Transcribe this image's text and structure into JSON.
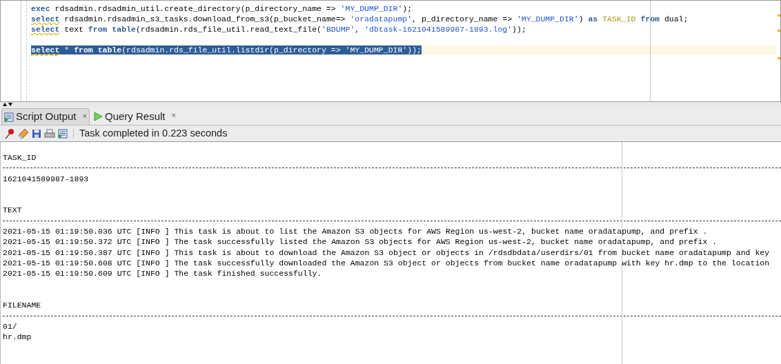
{
  "editor": {
    "lines": [
      {
        "selected": false,
        "tokens": [
          {
            "kind": "keyword",
            "text": "exec",
            "squiggle": false
          },
          {
            "kind": "plain",
            "text": " rdsadmin.rdsadmin_util.create_directory(p_directory_name => "
          },
          {
            "kind": "string",
            "text": "'MY_DUMP_DIR'"
          },
          {
            "kind": "plain",
            "text": ");"
          }
        ]
      },
      {
        "selected": false,
        "tokens": [
          {
            "kind": "keyword",
            "text": "select",
            "squiggle": true
          },
          {
            "kind": "plain",
            "text": " rdsadmin.rdsadmin_s3_tasks.download_from_s3(p_bucket_name=> "
          },
          {
            "kind": "string",
            "text": "'oradatapump'"
          },
          {
            "kind": "plain",
            "text": ", p_directory_name => "
          },
          {
            "kind": "string",
            "text": "'MY_DUMP_DIR'"
          },
          {
            "kind": "plain",
            "text": ") "
          },
          {
            "kind": "keyword",
            "text": "as",
            "squiggle": false
          },
          {
            "kind": "alias",
            "text": " TASK_ID"
          },
          {
            "kind": "keyword",
            "text": " from",
            "squiggle": false
          },
          {
            "kind": "plain",
            "text": " dual;"
          }
        ]
      },
      {
        "selected": false,
        "tokens": [
          {
            "kind": "keyword",
            "text": "select",
            "squiggle": true
          },
          {
            "kind": "plain",
            "text": " text "
          },
          {
            "kind": "keyword",
            "text": "from",
            "squiggle": false
          },
          {
            "kind": "keyword",
            "text": " table",
            "squiggle": false
          },
          {
            "kind": "plain",
            "text": "(rdsadmin.rds_file_util.read_text_file("
          },
          {
            "kind": "string",
            "text": "'BDUMP'"
          },
          {
            "kind": "plain",
            "text": ", "
          },
          {
            "kind": "string",
            "text": "'dbtask-1621041589987-1893.log'"
          },
          {
            "kind": "plain",
            "text": "));"
          }
        ]
      },
      {
        "selected": false
      },
      {
        "selected": true,
        "tokens": [
          {
            "kind": "keyword",
            "text": "select",
            "squiggle": true
          },
          {
            "kind": "plain",
            "text": " * "
          },
          {
            "kind": "keyword",
            "text": "from",
            "squiggle": false
          },
          {
            "kind": "keyword",
            "text": " table",
            "squiggle": false
          },
          {
            "kind": "plain",
            "text": "(rdsadmin.rds_file_util.listdir(p_directory => "
          },
          {
            "kind": "string",
            "text": "'MY_DUMP_DIR'"
          },
          {
            "kind": "plain",
            "text": "));"
          }
        ]
      }
    ]
  },
  "tabs": [
    {
      "label": "Script Output",
      "close": "×",
      "selected": true,
      "kind": "script"
    },
    {
      "label": "Query Result",
      "close": "×",
      "selected": false,
      "kind": "query"
    }
  ],
  "toolbar": {
    "status": "Task completed in 0.223 seconds"
  },
  "output": {
    "sections": [
      {
        "heading": "TASK_ID",
        "rows": [
          "1621041589987-1893"
        ]
      },
      {
        "heading": "TEXT",
        "rows": [
          "2021-05-15 01:19:50.036 UTC [INFO ] This task is about to list the Amazon S3 objects for AWS Region us-west-2, bucket name oradatapump, and prefix .",
          "2021-05-15 01:19:50.372 UTC [INFO ] The task successfully listed the Amazon S3 objects for AWS Region us-west-2, bucket name oradatapump, and prefix .",
          "2021-05-15 01:19:50.387 UTC [INFO ] This task is about to download the Amazon S3 object or objects in /rdsdbdata/userdirs/01 from bucket name oradatapump and key",
          "2021-05-15 01:19:50.608 UTC [INFO ] The task successfully downloaded the Amazon S3 object or objects from bucket name oradatapump with key hr.dmp to the location",
          "2021-05-15 01:19:50.609 UTC [INFO ] The task finished successfully."
        ]
      },
      {
        "heading": "FILENAME",
        "rows": [
          "01/",
          "hr.dmp"
        ]
      }
    ]
  }
}
